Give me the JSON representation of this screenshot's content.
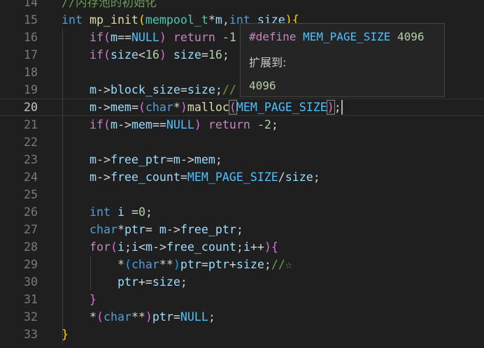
{
  "editor": {
    "lines": [
      {
        "num": "14",
        "tokens": [
          {
            "t": "//内存池的初始化",
            "c": "com"
          }
        ]
      },
      {
        "num": "15",
        "tokens": [
          {
            "t": "int",
            "c": "kw"
          },
          {
            "t": " ",
            "c": "plain"
          },
          {
            "t": "mp_init",
            "c": "fn"
          },
          {
            "t": "(",
            "c": "br1"
          },
          {
            "t": "mempool_t",
            "c": "type"
          },
          {
            "t": "*",
            "c": "op"
          },
          {
            "t": "m",
            "c": "var"
          },
          {
            "t": ",",
            "c": "plain"
          },
          {
            "t": "int",
            "c": "kw"
          },
          {
            "t": " ",
            "c": "plain"
          },
          {
            "t": "size",
            "c": "var"
          },
          {
            "t": ")",
            "c": "br1"
          },
          {
            "t": "{",
            "c": "br1"
          }
        ]
      },
      {
        "num": "16",
        "tokens": [
          {
            "t": "    ",
            "c": "plain"
          },
          {
            "t": "if",
            "c": "ctl"
          },
          {
            "t": "(",
            "c": "br2"
          },
          {
            "t": "m",
            "c": "var"
          },
          {
            "t": "==",
            "c": "op"
          },
          {
            "t": "NULL",
            "c": "mac"
          },
          {
            "t": ")",
            "c": "br2"
          },
          {
            "t": " ",
            "c": "plain"
          },
          {
            "t": "return",
            "c": "ctl"
          },
          {
            "t": " ",
            "c": "plain"
          },
          {
            "t": "-1",
            "c": "num"
          }
        ]
      },
      {
        "num": "17",
        "tokens": [
          {
            "t": "    ",
            "c": "plain"
          },
          {
            "t": "if",
            "c": "ctl"
          },
          {
            "t": "(",
            "c": "br2"
          },
          {
            "t": "size",
            "c": "var"
          },
          {
            "t": "<",
            "c": "op"
          },
          {
            "t": "16",
            "c": "num"
          },
          {
            "t": ")",
            "c": "br2"
          },
          {
            "t": " ",
            "c": "plain"
          },
          {
            "t": "size",
            "c": "var"
          },
          {
            "t": "=",
            "c": "op"
          },
          {
            "t": "16",
            "c": "num"
          },
          {
            "t": ";",
            "c": "plain"
          }
        ]
      },
      {
        "num": "18",
        "tokens": []
      },
      {
        "num": "19",
        "tokens": [
          {
            "t": "    ",
            "c": "plain"
          },
          {
            "t": "m",
            "c": "var"
          },
          {
            "t": "->",
            "c": "op"
          },
          {
            "t": "block_size",
            "c": "var"
          },
          {
            "t": "=",
            "c": "op"
          },
          {
            "t": "size",
            "c": "var"
          },
          {
            "t": ";",
            "c": "plain"
          },
          {
            "t": "//",
            "c": "com"
          }
        ]
      },
      {
        "num": "20",
        "current": true,
        "tokens": [
          {
            "t": "    ",
            "c": "plain"
          },
          {
            "t": "m",
            "c": "var"
          },
          {
            "t": "->",
            "c": "op"
          },
          {
            "t": "mem",
            "c": "var"
          },
          {
            "t": "=",
            "c": "op"
          },
          {
            "t": "(",
            "c": "br2"
          },
          {
            "t": "char",
            "c": "kw"
          },
          {
            "t": "*",
            "c": "op"
          },
          {
            "t": ")",
            "c": "br2"
          },
          {
            "t": "malloc",
            "c": "fn"
          },
          {
            "t": "(",
            "c": "br2",
            "box": true
          },
          {
            "t": "MEM_PAGE_SIZE",
            "c": "mac"
          },
          {
            "t": ")",
            "c": "br2",
            "box": true
          },
          {
            "t": ";",
            "c": "plain"
          }
        ]
      },
      {
        "num": "21",
        "tokens": [
          {
            "t": "    ",
            "c": "plain"
          },
          {
            "t": "if",
            "c": "ctl"
          },
          {
            "t": "(",
            "c": "br2"
          },
          {
            "t": "m",
            "c": "var"
          },
          {
            "t": "->",
            "c": "op"
          },
          {
            "t": "mem",
            "c": "var"
          },
          {
            "t": "==",
            "c": "op"
          },
          {
            "t": "NULL",
            "c": "mac"
          },
          {
            "t": ")",
            "c": "br2"
          },
          {
            "t": " ",
            "c": "plain"
          },
          {
            "t": "return",
            "c": "ctl"
          },
          {
            "t": " ",
            "c": "plain"
          },
          {
            "t": "-2",
            "c": "num"
          },
          {
            "t": ";",
            "c": "plain"
          }
        ]
      },
      {
        "num": "22",
        "tokens": []
      },
      {
        "num": "23",
        "tokens": [
          {
            "t": "    ",
            "c": "plain"
          },
          {
            "t": "m",
            "c": "var"
          },
          {
            "t": "->",
            "c": "op"
          },
          {
            "t": "free_ptr",
            "c": "var"
          },
          {
            "t": "=",
            "c": "op"
          },
          {
            "t": "m",
            "c": "var"
          },
          {
            "t": "->",
            "c": "op"
          },
          {
            "t": "mem",
            "c": "var"
          },
          {
            "t": ";",
            "c": "plain"
          }
        ]
      },
      {
        "num": "24",
        "tokens": [
          {
            "t": "    ",
            "c": "plain"
          },
          {
            "t": "m",
            "c": "var"
          },
          {
            "t": "->",
            "c": "op"
          },
          {
            "t": "free_count",
            "c": "var"
          },
          {
            "t": "=",
            "c": "op"
          },
          {
            "t": "MEM_PAGE_SIZE",
            "c": "mac"
          },
          {
            "t": "/",
            "c": "op"
          },
          {
            "t": "size",
            "c": "var"
          },
          {
            "t": ";",
            "c": "plain"
          }
        ]
      },
      {
        "num": "25",
        "tokens": []
      },
      {
        "num": "26",
        "tokens": [
          {
            "t": "    ",
            "c": "plain"
          },
          {
            "t": "int",
            "c": "kw"
          },
          {
            "t": " ",
            "c": "plain"
          },
          {
            "t": "i",
            "c": "var"
          },
          {
            "t": " =",
            "c": "op"
          },
          {
            "t": "0",
            "c": "num"
          },
          {
            "t": ";",
            "c": "plain"
          }
        ]
      },
      {
        "num": "27",
        "tokens": [
          {
            "t": "    ",
            "c": "plain"
          },
          {
            "t": "char",
            "c": "kw"
          },
          {
            "t": "*",
            "c": "op"
          },
          {
            "t": "ptr",
            "c": "var"
          },
          {
            "t": "=",
            "c": "op"
          },
          {
            "t": " ",
            "c": "plain"
          },
          {
            "t": "m",
            "c": "var"
          },
          {
            "t": "->",
            "c": "op"
          },
          {
            "t": "free_ptr",
            "c": "var"
          },
          {
            "t": ";",
            "c": "plain"
          }
        ]
      },
      {
        "num": "28",
        "tokens": [
          {
            "t": "    ",
            "c": "plain"
          },
          {
            "t": "for",
            "c": "ctl"
          },
          {
            "t": "(",
            "c": "br2"
          },
          {
            "t": "i",
            "c": "var"
          },
          {
            "t": ";",
            "c": "plain"
          },
          {
            "t": "i",
            "c": "var"
          },
          {
            "t": "<",
            "c": "op"
          },
          {
            "t": "m",
            "c": "var"
          },
          {
            "t": "->",
            "c": "op"
          },
          {
            "t": "free_count",
            "c": "var"
          },
          {
            "t": ";",
            "c": "plain"
          },
          {
            "t": "i",
            "c": "var"
          },
          {
            "t": "++",
            "c": "op"
          },
          {
            "t": ")",
            "c": "br2"
          },
          {
            "t": "{",
            "c": "br2"
          }
        ]
      },
      {
        "num": "29",
        "tokens": [
          {
            "t": "        ",
            "c": "plain"
          },
          {
            "t": "*",
            "c": "op"
          },
          {
            "t": "(",
            "c": "br3"
          },
          {
            "t": "char",
            "c": "kw"
          },
          {
            "t": "**",
            "c": "op"
          },
          {
            "t": ")",
            "c": "br3"
          },
          {
            "t": "ptr",
            "c": "var"
          },
          {
            "t": "=",
            "c": "op"
          },
          {
            "t": "ptr",
            "c": "var"
          },
          {
            "t": "+",
            "c": "op"
          },
          {
            "t": "size",
            "c": "var"
          },
          {
            "t": ";",
            "c": "plain"
          },
          {
            "t": "//☆",
            "c": "com"
          }
        ]
      },
      {
        "num": "30",
        "tokens": [
          {
            "t": "        ",
            "c": "plain"
          },
          {
            "t": "ptr",
            "c": "var"
          },
          {
            "t": "+=",
            "c": "op"
          },
          {
            "t": "size",
            "c": "var"
          },
          {
            "t": ";",
            "c": "plain"
          }
        ]
      },
      {
        "num": "31",
        "tokens": [
          {
            "t": "    ",
            "c": "plain"
          },
          {
            "t": "}",
            "c": "br2"
          }
        ]
      },
      {
        "num": "32",
        "tokens": [
          {
            "t": "    ",
            "c": "plain"
          },
          {
            "t": "*",
            "c": "op"
          },
          {
            "t": "(",
            "c": "br2"
          },
          {
            "t": "char",
            "c": "kw"
          },
          {
            "t": "**",
            "c": "op"
          },
          {
            "t": ")",
            "c": "br2"
          },
          {
            "t": "ptr",
            "c": "var"
          },
          {
            "t": "=",
            "c": "op"
          },
          {
            "t": "NULL",
            "c": "mac"
          },
          {
            "t": ";",
            "c": "plain"
          }
        ]
      },
      {
        "num": "33",
        "tokens": [
          {
            "t": "}",
            "c": "br1"
          }
        ]
      }
    ]
  },
  "tooltip": {
    "keyword": "#define",
    "macro_name": "MEM_PAGE_SIZE",
    "macro_value": "4096",
    "expands_label": "扩展到:",
    "expanded_value": "4096"
  },
  "colors": {
    "background": "#1f1f1f",
    "keyword": "#569cd6",
    "control": "#c586c0",
    "function": "#dcdcaa",
    "type": "#4ec9b0",
    "variable": "#9cdcfe",
    "macro": "#4fc1ff",
    "number": "#b5cea8",
    "comment": "#6a9955"
  }
}
